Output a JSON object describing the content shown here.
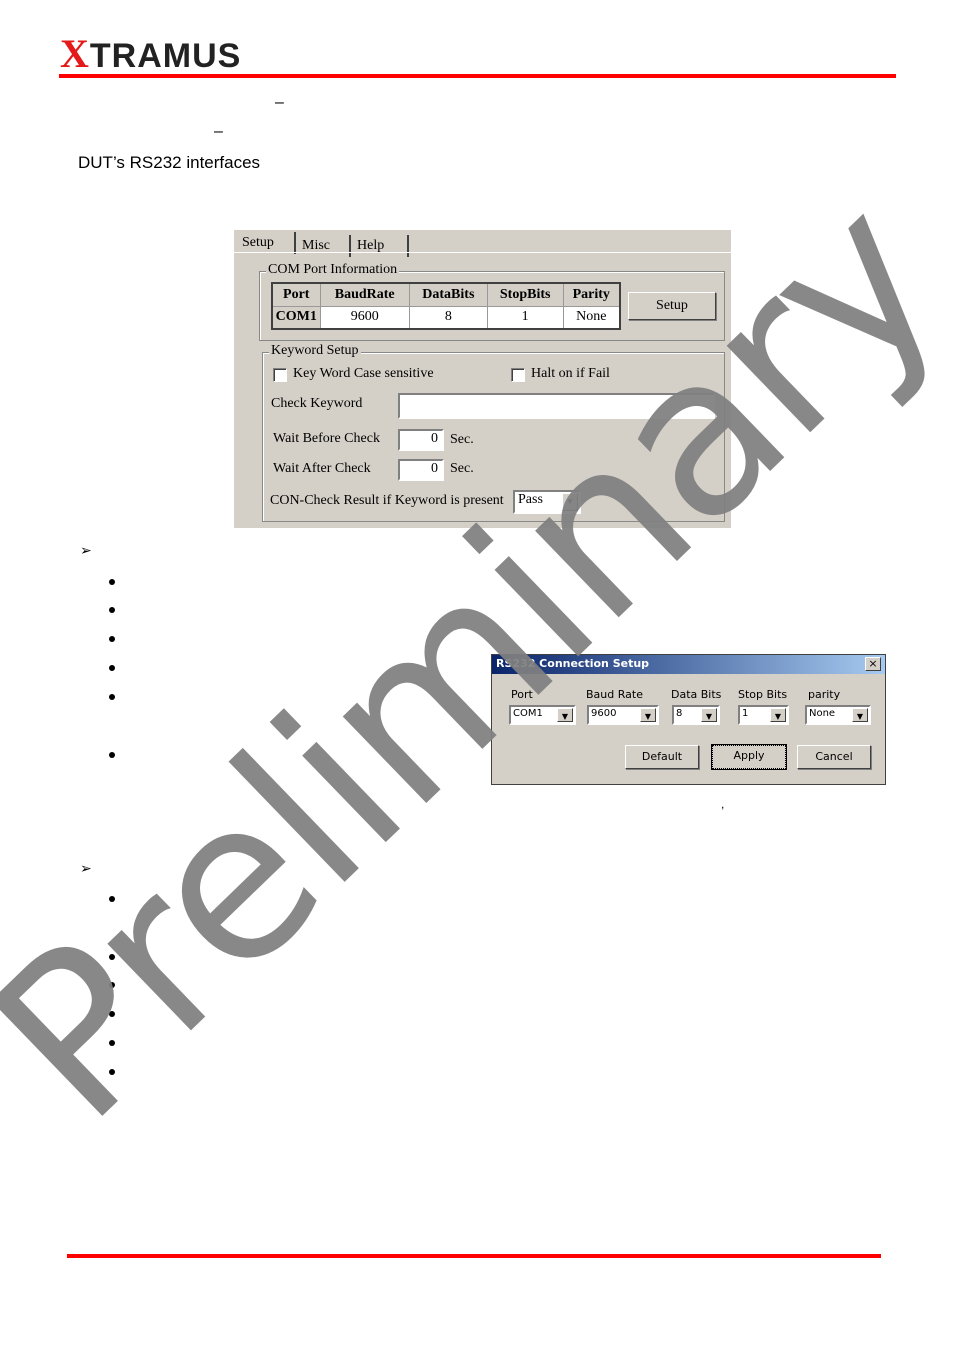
{
  "header": {
    "logo_x": "X",
    "logo_rest": "TRAMUS",
    "brand_color": "#ff0000"
  },
  "intro": {
    "dash1": "–",
    "dash2": "–",
    "line3": "DUT’s RS232 interfaces"
  },
  "setup_dialog": {
    "tabs": [
      "Setup",
      "Misc",
      "Help"
    ],
    "com_group": "COM Port Information",
    "columns": [
      "Port",
      "BaudRate",
      "DataBits",
      "StopBits",
      "Parity"
    ],
    "row": [
      "COM1",
      "9600",
      "8",
      "1",
      "None"
    ],
    "setup_button": "Setup",
    "keyword_group": "Keyword Setup",
    "case_sensitive": "Key Word Case sensitive",
    "halt_on_fail": "Halt on if Fail",
    "check_keyword": "Check Keyword",
    "check_keyword_value": "",
    "wait_before": "Wait Before Check",
    "wait_before_value": "0",
    "wait_after": "Wait After Check",
    "wait_after_value": "0",
    "sec": "Sec.",
    "result_label": "CON-Check Result if Keyword is present",
    "result_value": "Pass"
  },
  "rs232_dialog": {
    "title": "RS232 Connection Setup",
    "close": "×",
    "fields": [
      {
        "label": "Port",
        "value": "COM1"
      },
      {
        "label": "Baud Rate",
        "value": "9600"
      },
      {
        "label": "Data Bits",
        "value": "8"
      },
      {
        "label": "Stop Bits",
        "value": "1"
      },
      {
        "label": "parity",
        "value": "None"
      }
    ],
    "default": "Default",
    "apply": "Apply",
    "cancel": "Cancel"
  },
  "comma": ",",
  "arrow_glyph": "➢",
  "watermark": "Preliminary"
}
